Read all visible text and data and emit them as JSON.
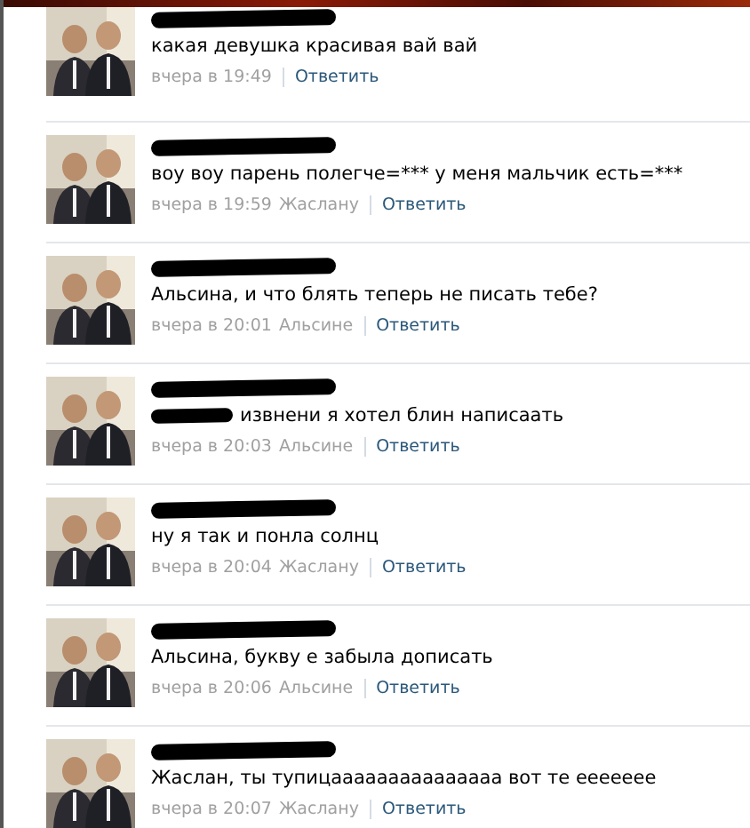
{
  "comments": [
    {
      "author_redacted": true,
      "text_redacted_prefix": false,
      "text": "какая девушка красивая вай вай",
      "date": "вчера в 19:49",
      "reply": "Ответить"
    },
    {
      "author_redacted": true,
      "text_redacted_prefix": false,
      "text": "воу воу парень полегче=*** у меня мальчик есть=***",
      "date": "вчера в 19:59",
      "reply_to": "Жаслану",
      "reply": "Ответить"
    },
    {
      "author_redacted": true,
      "text_redacted_prefix": false,
      "text": "Альсина, и что блять теперь не писать тебе?",
      "date": "вчера в 20:01",
      "reply_to": "Альсине",
      "reply": "Ответить"
    },
    {
      "author_redacted": true,
      "text_redacted_prefix": true,
      "text": "извнени я хотел блин написаать",
      "date": "вчера в 20:03",
      "reply_to": "Альсине",
      "reply": "Ответить"
    },
    {
      "author_redacted": true,
      "text_redacted_prefix": false,
      "text": "ну я так и понла солнц",
      "date": "вчера в 20:04",
      "reply_to": "Жаслану",
      "reply": "Ответить"
    },
    {
      "author_redacted": true,
      "text_redacted_prefix": false,
      "text": "Альсина, букву е забыла дописать",
      "date": "вчера в 20:06",
      "reply_to": "Альсине",
      "reply": "Ответить"
    },
    {
      "author_redacted": true,
      "text_redacted_prefix": false,
      "text": "Жаслан, ты тупицааааааааааааааа вот те еееееее",
      "date": "вчера в 20:07",
      "reply_to": "Жаслану",
      "reply": "Ответить"
    }
  ]
}
